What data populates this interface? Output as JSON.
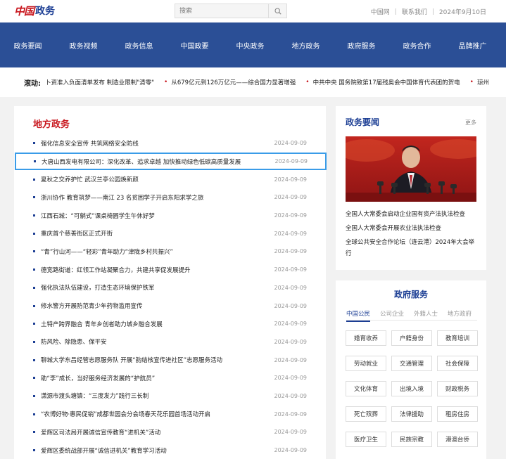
{
  "header": {
    "logo_mark": "中国",
    "logo_text": "政务",
    "search": {
      "placeholder": "搜索",
      "icon": "search-icon"
    },
    "links": [
      "中国网",
      "联系我们"
    ],
    "date": "2024年9月10日"
  },
  "nav": {
    "items": [
      "政务要闻",
      "政务视频",
      "政务信息",
      "中国政要",
      "中央政务",
      "地方政务",
      "政府服务",
      "政务合作",
      "品牌推广"
    ]
  },
  "ticker": {
    "label": "滚动:",
    "items": [
      "卜资准入负面清单发布 制造业限制\"清零\"",
      "从679亿元到126万亿元——综合国力显著增强",
      "中共中央 国务院致第17届残奥会中国体育代表团的贺电",
      "琼州"
    ]
  },
  "local_news": {
    "title": "地方政务",
    "rows": [
      {
        "title": "强化信息安全宣传 共筑网络安全防线",
        "date": "2024-09-09"
      },
      {
        "title": "大唐山西发电有限公司：深化改革、追求卓越 加快推动绿色低碳高质量发展",
        "date": "2024-09-09",
        "selected": true
      },
      {
        "title": "夏秋之交养护忙 武汉兰亭公园焕新颜",
        "date": "2024-09-09"
      },
      {
        "title": "浙川协作 教育筑梦——南江 23 名贫困学子开启东阳求学之旅",
        "date": "2024-09-09"
      },
      {
        "title": "江西石城：“可躺式”课桌椅圆学生午休好梦",
        "date": "2024-09-09"
      },
      {
        "title": "重庆首个慈善街区正式开街",
        "date": "2024-09-09"
      },
      {
        "title": "“青”行山河——“轻彩”青年助力“津陇乡村共振兴”",
        "date": "2024-09-09"
      },
      {
        "title": "德宽路街道：红领工作站凝聚合力，共建共享促发展提升",
        "date": "2024-09-09"
      },
      {
        "title": "强化执法队伍建设，打造生态环境保护铁军",
        "date": "2024-09-09"
      },
      {
        "title": "修水警方开展防范青少年药物滥用宣传",
        "date": "2024-09-09"
      },
      {
        "title": "土特产跨界融合 青年乡创者助力城乡融合发展",
        "date": "2024-09-09"
      },
      {
        "title": "防风险、除隐患、保平安",
        "date": "2024-09-09"
      },
      {
        "title": "聊城大学东昌经管志愿服务队 开展“韵结核宣传进社区”志愿服务活动",
        "date": "2024-09-09"
      },
      {
        "title": "助“李”成长，当好服务经济发展的“护航员”",
        "date": "2024-09-09"
      },
      {
        "title": "潇源市渡头塘镇：“三度发力”践行三长制",
        "date": "2024-09-09"
      },
      {
        "title": "“农博好物·惠民促销”成都世园会分会场春天花乐园首场活动开启",
        "date": "2024-09-09"
      },
      {
        "title": "爱辉区司法局开展诚信宣传教育“进机关”活动",
        "date": "2024-09-09"
      },
      {
        "title": "爱辉区委统战部开展“诚信进机关”教育学习活动",
        "date": "2024-09-09"
      }
    ]
  },
  "gov_news": {
    "title": "政务要闻",
    "more": "更多",
    "photo_colors": {
      "background": "#b01a1a",
      "accent": "#e03a2a"
    },
    "items": [
      "全国人大常委会启动企业国有资产法执法检查",
      "全国人大常委会开展农业法执法检查",
      "全球公共安全合作论坛（连云港）2024年大会举行"
    ]
  },
  "services": {
    "title": "政府服务",
    "tabs": [
      "中国公民",
      "公司企业",
      "外籍人士",
      "地方政府"
    ],
    "active_tab": 0,
    "buttons": [
      "婚育收养",
      "户籍身份",
      "教育培训",
      "劳动就业",
      "交通管理",
      "社会保障",
      "文化体育",
      "出境入境",
      "财政税务",
      "死亡殡葬",
      "法律援助",
      "租房住房",
      "医疗卫生",
      "民族宗教",
      "港澳台侨"
    ]
  },
  "colors": {
    "brand_red": "#c8161d",
    "brand_blue": "#1c3e94",
    "nav_bg": "#2b4f96",
    "selection": "#3a9ce8"
  }
}
